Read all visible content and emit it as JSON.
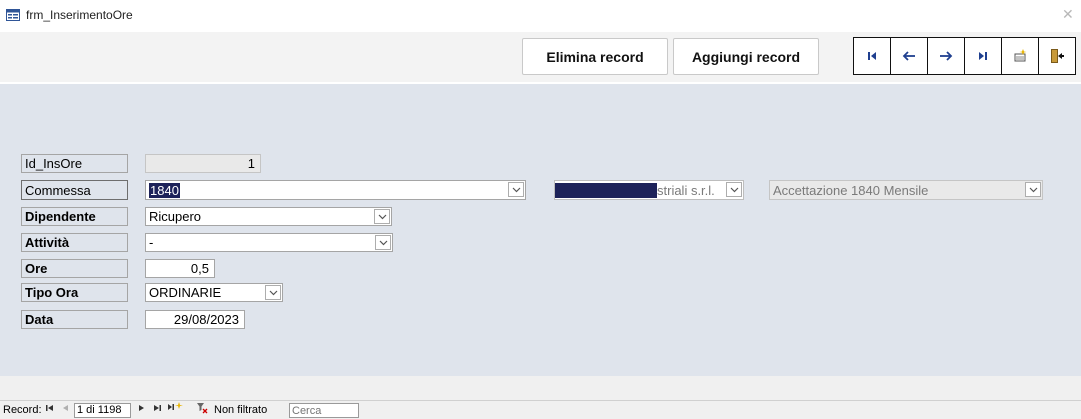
{
  "window": {
    "title": "frm_InserimentoOre",
    "close_icon": "close-icon"
  },
  "header": {
    "delete_label": "Elimina record",
    "add_label": "Aggiungi record",
    "nav_buttons": [
      "first-record-icon",
      "previous-record-icon",
      "next-record-icon",
      "last-record-icon",
      "new-record-icon",
      "exit-icon"
    ]
  },
  "form": {
    "id_label": "Id_InsOre",
    "id_value": "1",
    "commessa_label": "Commessa",
    "commessa_value": "1840",
    "cliente_value": "striali s.r.l.",
    "descrizione_value": "Accettazione 1840 Mensile",
    "dipendente_label": "Dipendente",
    "dipendente_value": "Ricupero",
    "attivita_label": "Attività",
    "attivita_value": "-",
    "ore_label": "Ore",
    "ore_value": "0,5",
    "tipo_ora_label": "Tipo Ora",
    "tipo_ora_value": "ORDINARIE",
    "data_label": "Data",
    "data_value": "29/08/2023"
  },
  "statusbar": {
    "record_label": "Record:",
    "position": "1 di 1198",
    "filter_text": "Non filtrato",
    "search_placeholder": "Cerca"
  },
  "colors": {
    "detail_bg": "#dfe4ec",
    "selection": "#1d2259",
    "nav_icon": "#1f3f8f"
  }
}
